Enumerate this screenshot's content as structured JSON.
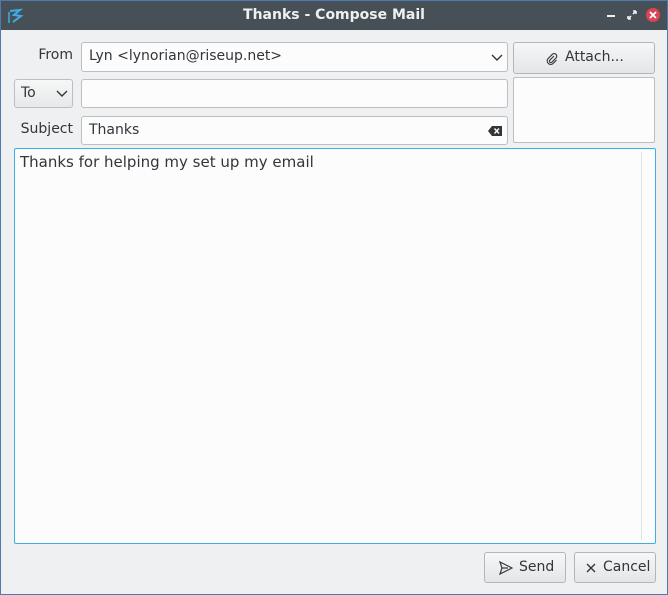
{
  "window": {
    "title": "Thanks - Compose Mail"
  },
  "from": {
    "label": "From",
    "value": "Lyn <lynorian@riseup.net>"
  },
  "to": {
    "type_value": "To",
    "value": ""
  },
  "subject": {
    "label": "Subject",
    "value": "Thanks"
  },
  "attach": {
    "label": "Attach..."
  },
  "body": {
    "text": "Thanks for helping my set up my email"
  },
  "actions": {
    "send_label": "Send",
    "cancel_label": "Cancel"
  },
  "colors": {
    "titlebar": "#475057",
    "accent": "#3daee9",
    "close": "#da4453"
  },
  "icons": [
    "app-logo-icon",
    "minimize-icon",
    "maximize-icon",
    "close-icon",
    "chevron-down-icon",
    "paperclip-icon",
    "clear-text-icon",
    "send-icon",
    "cancel-icon"
  ]
}
